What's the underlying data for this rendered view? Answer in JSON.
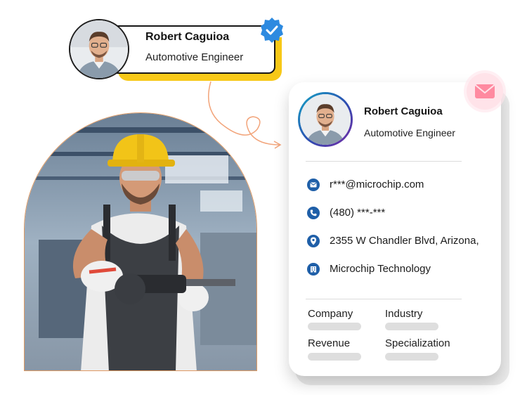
{
  "badge": {
    "name": "Robert Caguioa",
    "title": "Automotive Engineer"
  },
  "card": {
    "name": "Robert Caguioa",
    "title": "Automotive Engineer",
    "contacts": [
      {
        "icon": "email-icon",
        "text": "r***@microchip.com"
      },
      {
        "icon": "phone-icon",
        "text": "(480) ***-***"
      },
      {
        "icon": "location-pin-icon",
        "text": "2355 W Chandler Blvd, Arizona,"
      },
      {
        "icon": "building-icon",
        "text": "Microchip Technology"
      }
    ],
    "fields": [
      "Company",
      "Industry",
      "Revenue",
      "Specialization"
    ]
  },
  "colors": {
    "accent_yellow": "#f7c817",
    "verified_blue": "#2d8ae0",
    "icon_blue": "#1f5fa8",
    "connector_orange": "#f2a47a",
    "mail_pink": "#ff8aa0"
  }
}
